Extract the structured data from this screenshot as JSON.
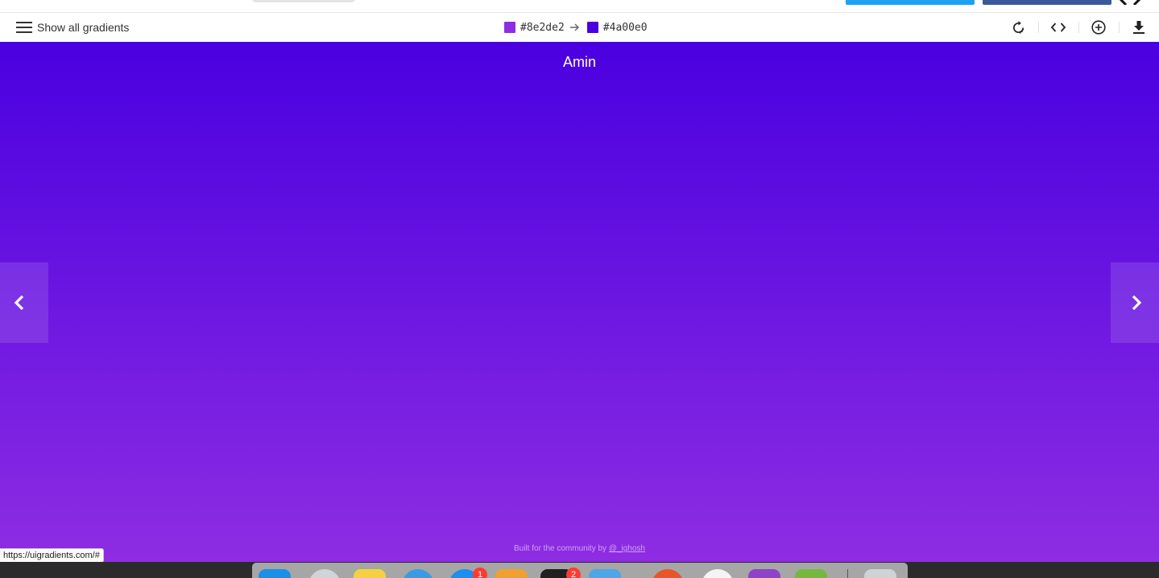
{
  "toolbar": {
    "menu_label": "Show all gradients",
    "color_from": {
      "hex": "#8e2de2"
    },
    "color_to": {
      "hex": "#4a00e0"
    },
    "tools": [
      {
        "icon": "rotate-icon"
      },
      {
        "icon": "code-icon"
      },
      {
        "icon": "add-circle-icon"
      },
      {
        "icon": "download-icon"
      }
    ]
  },
  "gradient": {
    "name": "Amin",
    "direction": "to top",
    "colors": [
      "#8e2de2",
      "#4a00e0"
    ]
  },
  "navigation": {
    "prev_icon": "chevron-left-icon",
    "next_icon": "chevron-right-icon"
  },
  "footer": {
    "text": "Built for the community by",
    "author_link": "@_ighosh"
  },
  "status_bar": {
    "url": "https://uigradients.com/#"
  },
  "dock": {
    "badges": [
      "1",
      "2"
    ]
  }
}
